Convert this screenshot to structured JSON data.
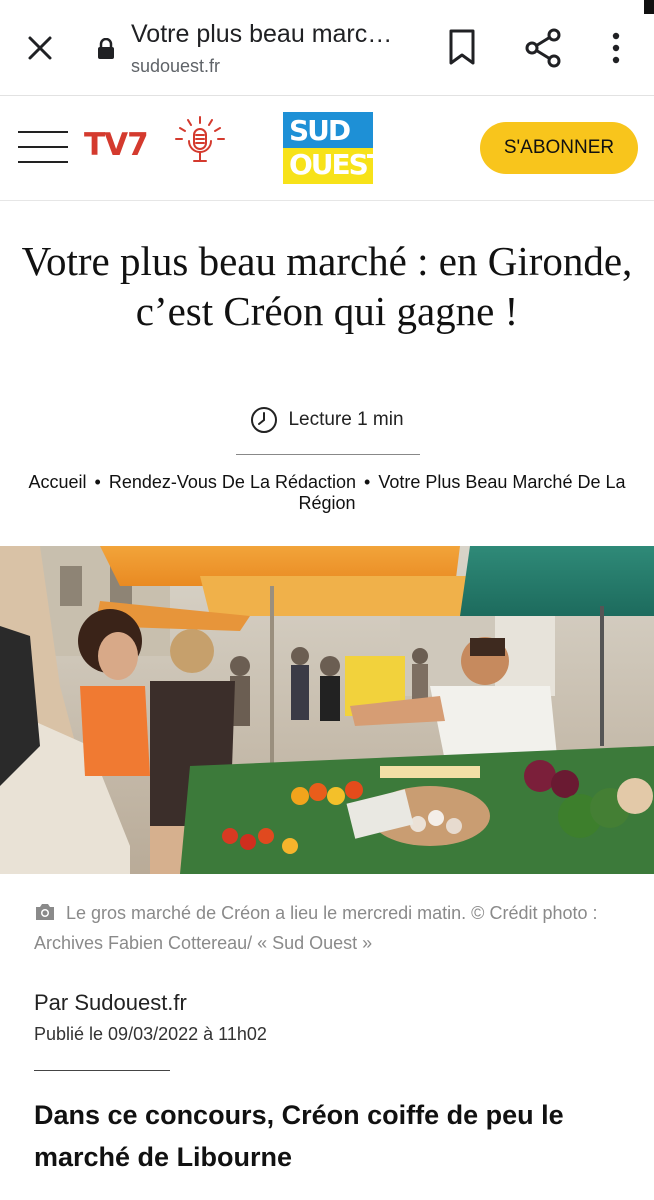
{
  "browser": {
    "page_title": "Votre plus beau marc…",
    "url": "sudouest.fr"
  },
  "header": {
    "tv7_label": "TV7",
    "logo_line1": "SUD",
    "logo_line2": "OUEST",
    "subscribe_label": "S'ABONNER"
  },
  "article": {
    "headline": "Votre plus beau marché : en Gironde, c’est Créon qui gagne !",
    "reading_time": "Lecture 1 min",
    "breadcrumb": [
      {
        "label": "Accueil"
      },
      {
        "label": "Rendez-Vous De La Rédaction"
      },
      {
        "label": "Votre Plus Beau Marché De La Région"
      }
    ],
    "breadcrumb_separator": "•",
    "photo_caption": "Le gros marché de Créon a lieu le mercredi matin. © Crédit photo : Archives Fabien Cottereau/ « Sud Ouest »",
    "author": "Par Sudouest.fr",
    "published": "Publié le 09/03/2022 à 11h02",
    "subheading": "Dans ce concours, Créon coiffe de peu le marché de Libourne"
  },
  "colors": {
    "brand_red": "#d43a2e",
    "logo_blue": "#1e90d6",
    "logo_yellow": "#f7e219",
    "subscribe_yellow": "#f8c51c",
    "caption_gray": "#8a8a8a"
  },
  "icons": [
    "close-icon",
    "lock-icon",
    "bookmark-icon",
    "share-icon",
    "more-vert-icon",
    "menu-icon",
    "microphone-icon",
    "clock-icon",
    "camera-icon"
  ]
}
